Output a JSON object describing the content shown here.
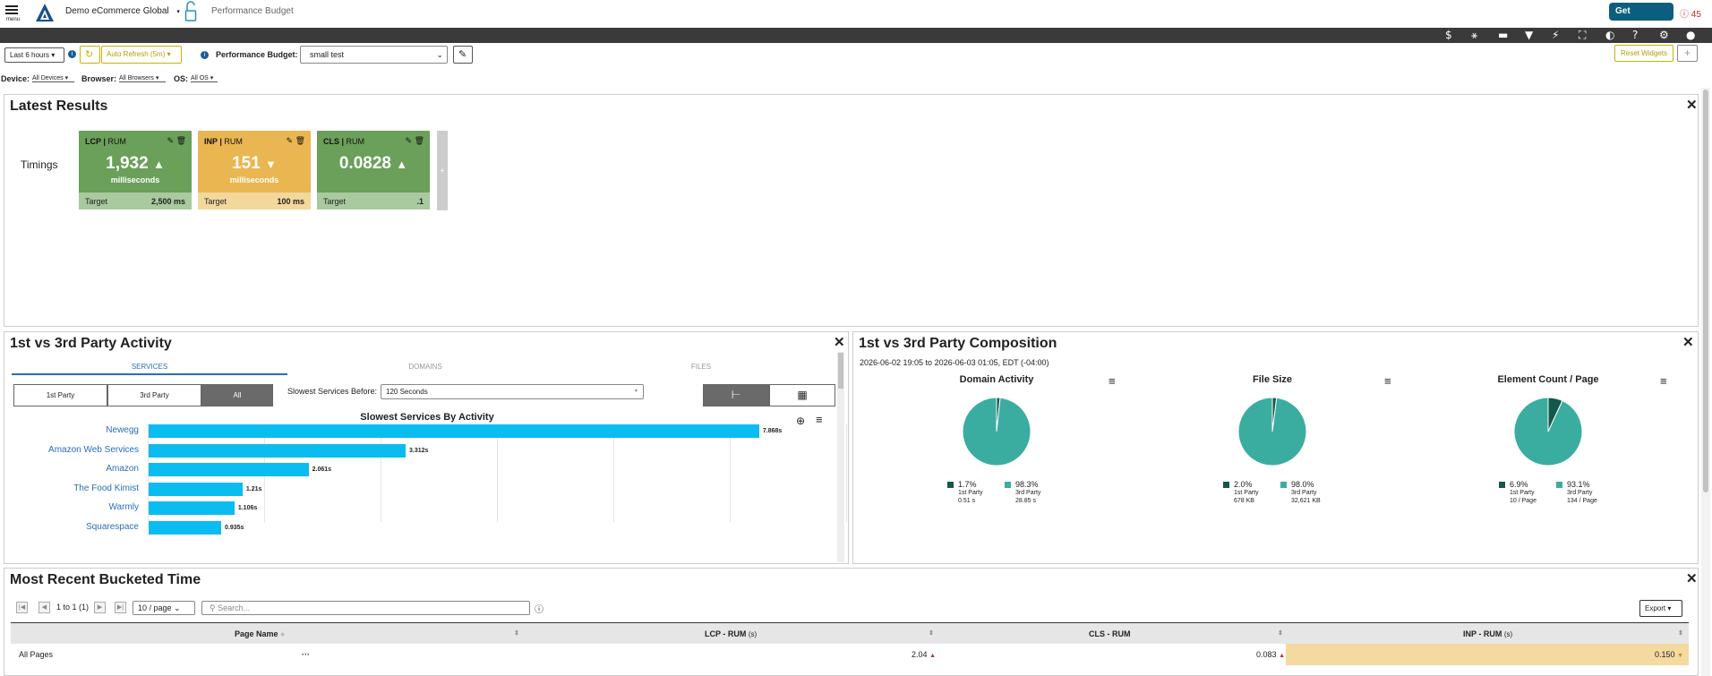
{
  "header": {
    "menu_label": "menu",
    "org": "Demo eCommerce Global",
    "page": "Performance Budget",
    "get_started": "Get started",
    "alerts": "45"
  },
  "toolbar": {
    "time_range": "Last 6 hours",
    "auto_refresh": "Auto Refresh (5m)",
    "budget_label": "Performance Budget:",
    "budget_value": "small test",
    "reset_widgets": "Reset Widgets",
    "add": "+"
  },
  "filters": {
    "device_label": "Device:",
    "device_value": "All Devices",
    "browser_label": "Browser:",
    "browser_value": "All Browsers",
    "os_label": "OS:",
    "os_value": "All OS"
  },
  "latest": {
    "title": "Latest Results",
    "row_label": "Timings",
    "tiles": [
      {
        "metric": "LCP",
        "source": "RUM",
        "value": "1,932",
        "unit": "milliseconds",
        "trend": "up",
        "target_label": "Target",
        "target": "2,500 ms",
        "color": "#6aa05a",
        "foot": "#a9c99f"
      },
      {
        "metric": "INP",
        "source": "RUM",
        "value": "151",
        "unit": "milliseconds",
        "trend": "down",
        "target_label": "Target",
        "target": "100 ms",
        "color": "#e9b651",
        "foot": "#f3d89b"
      },
      {
        "metric": "CLS",
        "source": "RUM",
        "value": "0.0828",
        "unit": "",
        "trend": "up",
        "target_label": "Target",
        "target": ".1",
        "color": "#6aa05a",
        "foot": "#a9c99f"
      }
    ]
  },
  "activity": {
    "title": "1st vs 3rd Party Activity",
    "tabs": [
      "SERVICES",
      "DOMAINS",
      "FILES"
    ],
    "party": [
      "1st Party",
      "3rd Party",
      "All"
    ],
    "slowest_label": "Slowest Services Before:",
    "slowest_value": "120 Seconds"
  },
  "chart_data": [
    {
      "type": "bar",
      "title": "Slowest Services By Activity",
      "subtitle": "2026-06-02 19:05 to 2026-06-03 01:05, EDT (-04:00)",
      "categories": [
        "Newegg",
        "Amazon Web Services",
        "Amazon",
        "The Food Kimist",
        "Warmly",
        "Squarespace"
      ],
      "values": [
        7.868,
        3.312,
        2.061,
        1.21,
        1.106,
        0.935
      ],
      "value_labels": [
        "7.868s",
        "3.312s",
        "2.061s",
        "1.21s",
        "1.106s",
        "0.935s"
      ],
      "xlim": [
        0,
        9
      ]
    },
    {
      "type": "pie",
      "title": "Domain Activity",
      "values": [
        1.7,
        98.3
      ],
      "labels": [
        "1st Party",
        "3rd Party"
      ],
      "pct": [
        "1.7%",
        "98.3%"
      ],
      "detail": [
        "0.51 s",
        "28.85 s"
      ]
    },
    {
      "type": "pie",
      "title": "File Size",
      "values": [
        2.0,
        98.0
      ],
      "labels": [
        "1st Party",
        "3rd Party"
      ],
      "pct": [
        "2.0%",
        "98.0%"
      ],
      "detail": [
        "678 KB",
        "32,621 KB"
      ]
    },
    {
      "type": "pie",
      "title": "Element Count / Page",
      "values": [
        6.9,
        93.1
      ],
      "labels": [
        "1st Party",
        "3rd Party"
      ],
      "pct": [
        "6.9%",
        "93.1%"
      ],
      "detail": [
        "10 / Page",
        "134 / Page"
      ]
    }
  ],
  "composition": {
    "title": "1st vs 3rd Party Composition",
    "subtitle": "2026-06-02 19:05 to 2026-06-03 01:05, EDT (-04:00)",
    "colors": [
      "#14584a",
      "#3aada0"
    ]
  },
  "bucketed": {
    "title": "Most Recent Bucketed Time",
    "paging": "1 to 1 (1)",
    "per_page": "10 / page",
    "search_placeholder": "Search...",
    "export": "Export",
    "columns": [
      "Page Name",
      "LCP - RUM",
      "CLS - RUM",
      "INP - RUM"
    ],
    "units": [
      "",
      "(s)",
      "",
      "(s)"
    ],
    "rows": [
      {
        "page": "All Pages",
        "dots": "···",
        "lcp": "2.04",
        "cls": "0.083",
        "inp": "0.150"
      }
    ]
  }
}
